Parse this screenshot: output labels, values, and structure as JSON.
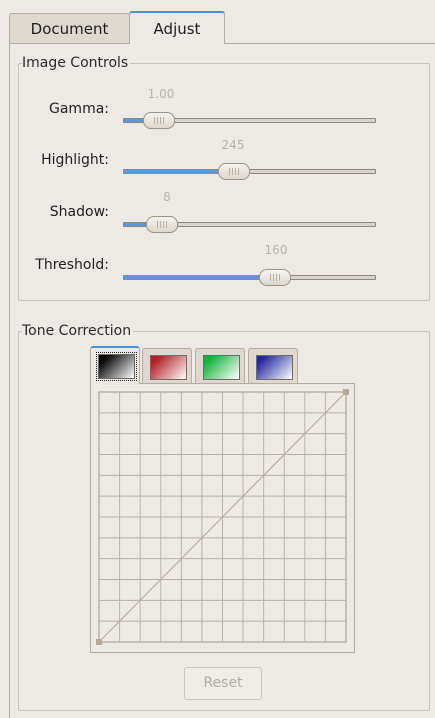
{
  "tabs": [
    {
      "label": "Document",
      "active": false
    },
    {
      "label": "Adjust",
      "active": true
    }
  ],
  "image_controls": {
    "title": "Image Controls",
    "sliders": [
      {
        "label": "Gamma:",
        "value": "1.00",
        "fraction": 0.14
      },
      {
        "label": "Highlight:",
        "value": "245",
        "fraction": 0.44
      },
      {
        "label": "Shadow:",
        "value": "8",
        "fraction": 0.15
      },
      {
        "label": "Threshold:",
        "value": "160",
        "fraction": 0.6
      }
    ]
  },
  "tone_correction": {
    "title": "Tone Correction",
    "channels": [
      {
        "name": "gray-channel-icon",
        "color": "#000000",
        "active": true
      },
      {
        "name": "red-channel-icon",
        "color": "#b21e25",
        "active": false
      },
      {
        "name": "green-channel-icon",
        "color": "#19b23d",
        "active": false
      },
      {
        "name": "blue-channel-icon",
        "color": "#242aa1",
        "active": false
      }
    ],
    "reset_label": "Reset"
  },
  "colors": {
    "accent": "#4d92d8",
    "slider_fill": "#5b98db",
    "background": "#edeae5"
  }
}
